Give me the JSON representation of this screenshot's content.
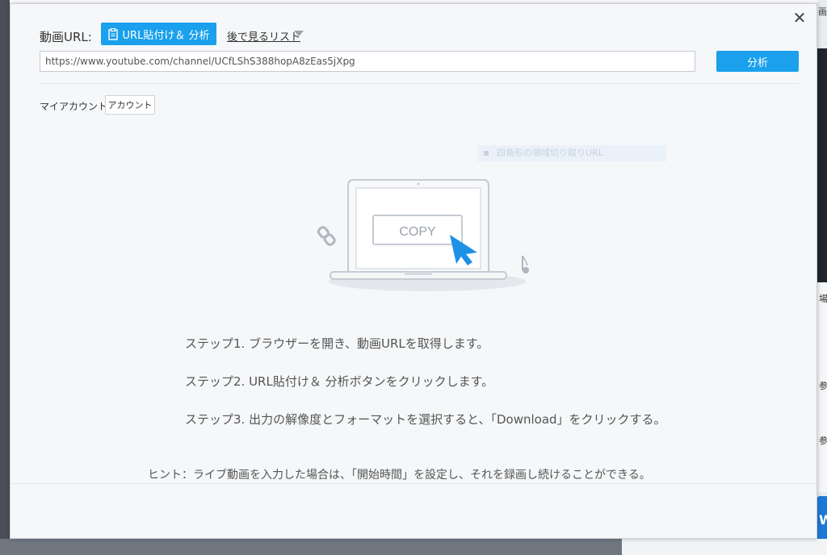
{
  "dialog": {
    "close_label": "✕",
    "url_label": "動画URL:",
    "paste_button_label": "URL貼付け＆ 分析",
    "watch_later_label": "後で見るリスト",
    "url_value": "https://www.youtube.com/channel/UCfLShS388hopA8zEas5jXpg",
    "analyze_button_label": "分析",
    "account_label": "マイアカウント",
    "account_button_label": "アカウント",
    "ghost_tip_text": "四角形の領域切り取りURL",
    "copy_label": "COPY",
    "steps": [
      {
        "prefix": "ステップ1.",
        "text": " ブラウザーを開き、動画URLを取得します。"
      },
      {
        "prefix": "ステップ2.",
        "text": " URL貼付け＆ 分析ボタンをクリックします。"
      },
      {
        "prefix": "ステップ3.",
        "text": " 出力の解像度とフォーマットを選択すると、「Download」をクリックする。"
      }
    ],
    "hint": "ヒント：ライブ動画を入力した場合は、「開始時間」を設定し、それを録画し続けることができる。"
  },
  "background": {
    "right_fragments": [
      "画",
      "場",
      "参",
      "参",
      "W"
    ]
  },
  "colors": {
    "accent": "#1aa0ec",
    "dialog_bg": "#f5f7f9",
    "illustration_stroke": "#c5cbd3"
  }
}
